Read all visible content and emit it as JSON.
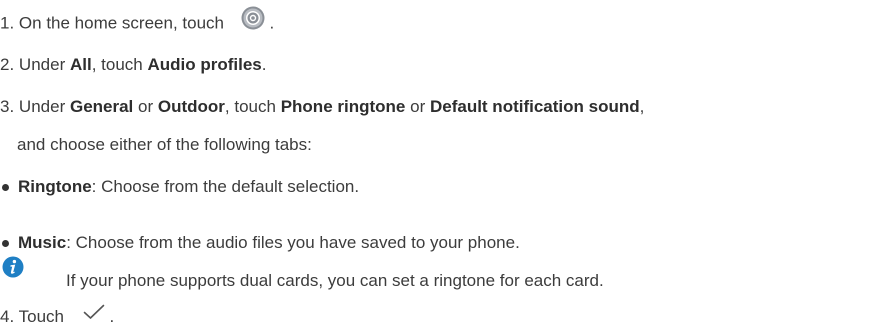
{
  "steps": {
    "s1": {
      "num": "1.",
      "text": "On the home screen, touch",
      "end": "."
    },
    "s2": {
      "num": "2.",
      "pre": "Under",
      "b1": "All",
      "mid": ", touch",
      "b2": "Audio profiles",
      "end": "."
    },
    "s3": {
      "num": "3.",
      "pre": "Under",
      "b1": "General",
      "or1": "or",
      "b2": "Outdoor",
      "mid": ", touch",
      "b3": "Phone ringtone",
      "or2": "or",
      "b4": "Default notification sound",
      "end": ",",
      "line2": "and choose either of the following tabs:"
    },
    "s4": {
      "num": "4.",
      "text": "Touch",
      "end": "."
    }
  },
  "bullets": [
    {
      "term": "Ringtone",
      "desc": ": Choose from the default selection."
    },
    {
      "term": "Music",
      "desc": ": Choose from the audio files you have saved to your phone."
    }
  ],
  "note": {
    "text": "If your phone supports dual cards, you can set a ringtone for each card."
  },
  "icons": {
    "settings": "settings-icon",
    "info": "info-icon",
    "check": "checkmark-icon"
  },
  "colors": {
    "text": "#3c3c3c",
    "info_blue": "#1f7fc4"
  }
}
